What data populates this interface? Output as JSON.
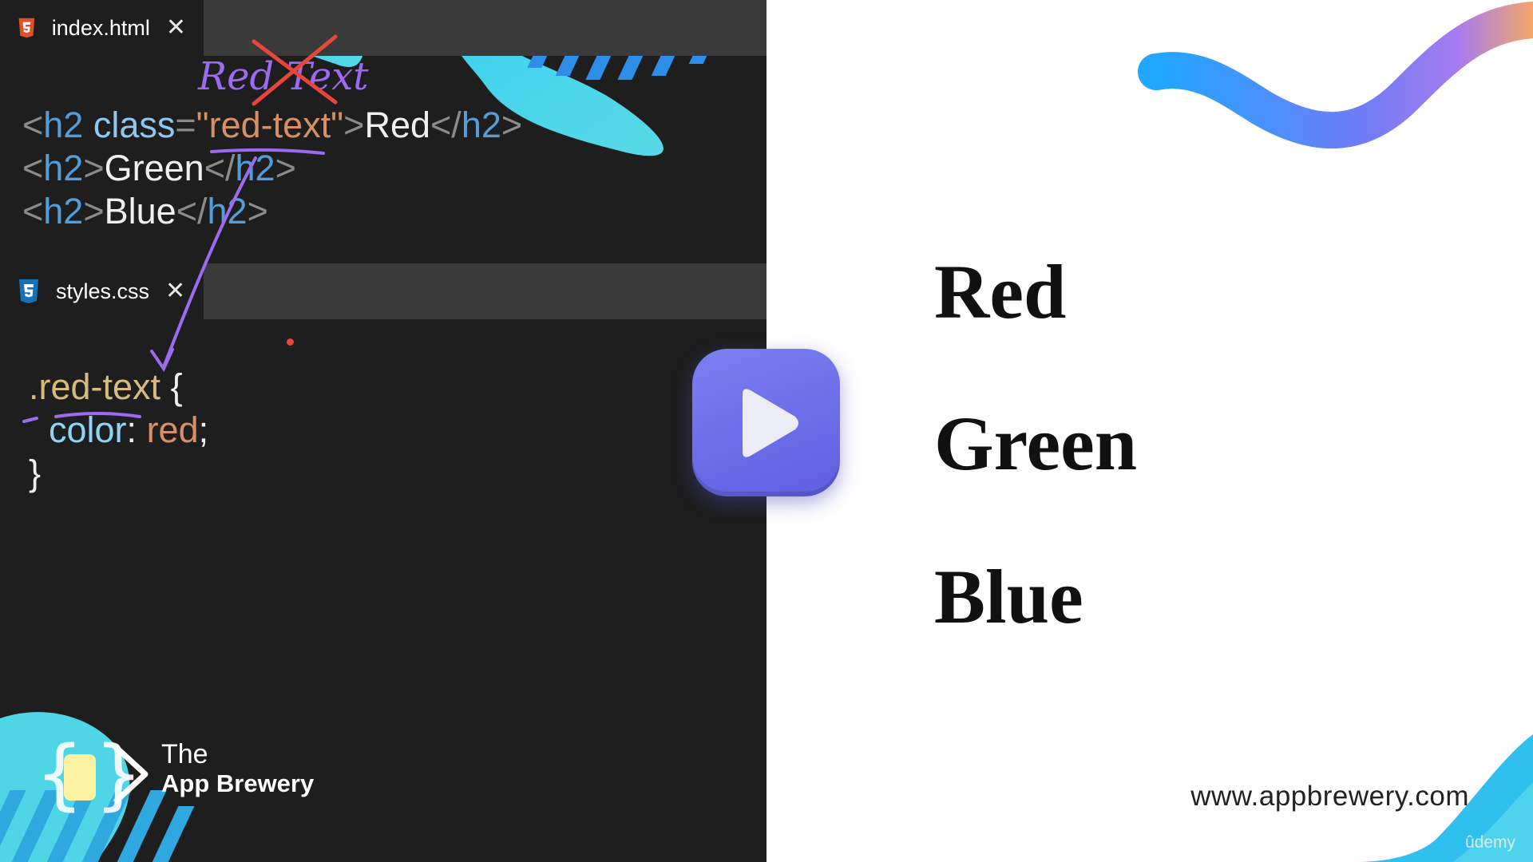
{
  "tabs": {
    "html": {
      "label": "index.html",
      "close": "✕",
      "icon": "html5-icon"
    },
    "css": {
      "label": "styles.css",
      "close": "✕",
      "icon": "css3-icon"
    }
  },
  "html_code": [
    [
      {
        "t": "<",
        "c": "punc"
      },
      {
        "t": "h2",
        "c": "tag"
      },
      {
        "t": " class",
        "c": "attr"
      },
      {
        "t": "=",
        "c": "punc"
      },
      {
        "t": "\"red-text\"",
        "c": "str"
      },
      {
        "t": ">",
        "c": "punc"
      },
      {
        "t": "Red",
        "c": "text"
      },
      {
        "t": "</",
        "c": "punc"
      },
      {
        "t": "h2",
        "c": "tag"
      },
      {
        "t": ">",
        "c": "punc"
      }
    ],
    [
      {
        "t": "<",
        "c": "punc"
      },
      {
        "t": "h2",
        "c": "tag"
      },
      {
        "t": ">",
        "c": "punc"
      },
      {
        "t": "Green",
        "c": "text"
      },
      {
        "t": "</",
        "c": "punc"
      },
      {
        "t": "h2",
        "c": "tag"
      },
      {
        "t": ">",
        "c": "punc"
      }
    ],
    [
      {
        "t": "<",
        "c": "punc"
      },
      {
        "t": "h2",
        "c": "tag"
      },
      {
        "t": ">",
        "c": "punc"
      },
      {
        "t": "Blue",
        "c": "text"
      },
      {
        "t": "</",
        "c": "punc"
      },
      {
        "t": "h2",
        "c": "tag"
      },
      {
        "t": ">",
        "c": "punc"
      }
    ]
  ],
  "css_code": [
    [
      {
        "t": ".red-text",
        "c": "sel"
      },
      {
        "t": " {",
        "c": "text"
      }
    ],
    [
      {
        "t": "  color",
        "c": "prop"
      },
      {
        "t": ": ",
        "c": "text"
      },
      {
        "t": "red",
        "c": "val"
      },
      {
        "t": ";",
        "c": "text"
      }
    ],
    [
      {
        "t": "}",
        "c": "text"
      }
    ]
  ],
  "annotation": {
    "handwriting": "Red Text",
    "handwriting_color": "#9b6bf0",
    "strike_color": "#e8453c"
  },
  "preview": {
    "headings": [
      "Red",
      "Green",
      "Blue"
    ]
  },
  "play_button": {
    "icon": "play-icon"
  },
  "brand": {
    "line1": "The",
    "line2": "App Brewery",
    "logo_icon": "app-brewery-logo-icon"
  },
  "footer": {
    "url": "www.appbrewery.com",
    "watermark": "ûdemy"
  },
  "colors": {
    "editor_bg": "#1e1e1e",
    "tabbar_bg": "#3a3a3a",
    "accent_cyan": "#4fd6e6",
    "accent_blue": "#2f9bff",
    "accent_purple": "#a67bf0",
    "accent_orange": "#f3a76a",
    "play_button": "#6d6deb"
  }
}
